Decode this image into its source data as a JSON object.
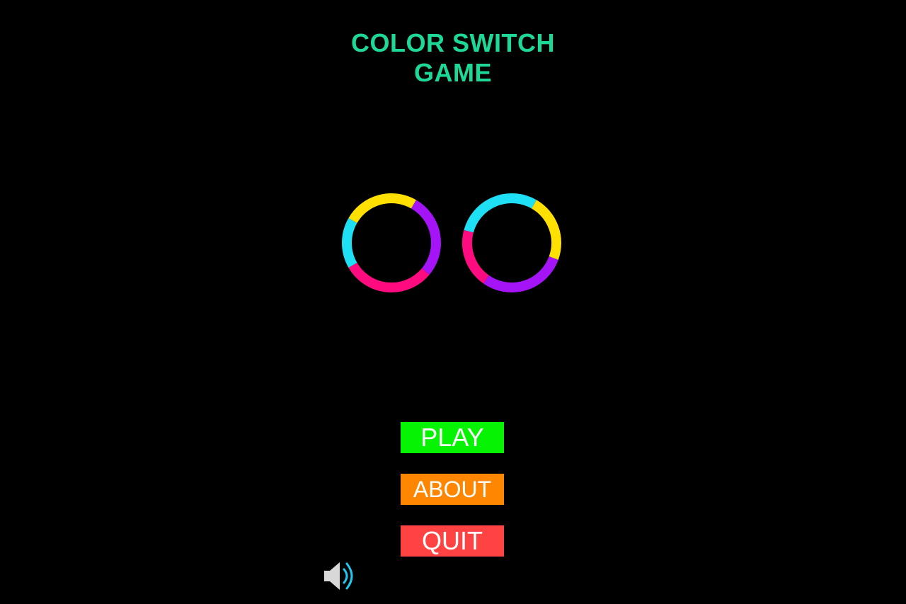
{
  "title": {
    "line1": "COLOR SWITCH",
    "line2": "GAME"
  },
  "colors": {
    "background": "#000000",
    "title": "#1ed898",
    "cyan": "#1fdff5",
    "yellow": "#ffe000",
    "purple": "#a514f6",
    "pink": "#ff0b80",
    "play": "#06f404",
    "about": "#ff8600",
    "quit": "#ff4343",
    "sound_body": "#d8d8d8",
    "sound_wave": "#1fc9f2"
  },
  "logo_rings": [
    {
      "name": "left-ring",
      "segments": [
        {
          "color": "yellow",
          "from_deg": -60,
          "to_deg": 30
        },
        {
          "color": "purple",
          "from_deg": 30,
          "to_deg": 130
        },
        {
          "color": "pink",
          "from_deg": 130,
          "to_deg": 240
        },
        {
          "color": "cyan",
          "from_deg": 240,
          "to_deg": 300
        }
      ]
    },
    {
      "name": "right-ring",
      "segments": [
        {
          "color": "cyan",
          "from_deg": -75,
          "to_deg": 30
        },
        {
          "color": "yellow",
          "from_deg": 30,
          "to_deg": 110
        },
        {
          "color": "purple",
          "from_deg": 110,
          "to_deg": 215
        },
        {
          "color": "pink",
          "from_deg": 215,
          "to_deg": 285
        }
      ]
    }
  ],
  "menu": {
    "play": "PLAY",
    "about": "ABOUT",
    "quit": "QUIT"
  },
  "sound": {
    "icon": "speaker-on-icon"
  }
}
